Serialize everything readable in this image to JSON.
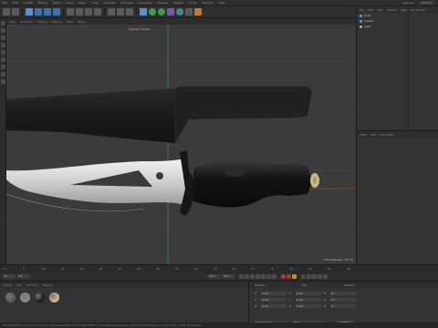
{
  "app": {
    "menu": [
      "File",
      "Edit",
      "Create",
      "Modes",
      "Select",
      "Tools",
      "Mesh",
      "Snap",
      "Animate",
      "Simulate",
      "Character",
      "Pipeline",
      "Plugins",
      "Script",
      "Window",
      "Help"
    ],
    "layout_label": "Layout:",
    "layout_value": "Startup"
  },
  "viewport": {
    "menu": [
      "View",
      "Cameras",
      "Display",
      "Options",
      "Filter",
      "Panel"
    ],
    "camera_label": "Default Camera",
    "grid_spacing": "Grid Spacing : 10 cm",
    "colors": {
      "background": "#3b3b3b",
      "grid_major": "#474747",
      "y_axis": "#3a9a4a",
      "x_axis": "#b24a2a",
      "sheath": "#1a1a1a",
      "blade": "#d8d8d8",
      "handle": "#111111",
      "pommel": "#c9b98a"
    }
  },
  "object_manager": {
    "menu": [
      "File",
      "Edit",
      "View",
      "Objects",
      "Tags",
      "Bookmarks"
    ],
    "objects": [
      {
        "name": "Knife",
        "icon": "null-object-icon"
      },
      {
        "name": "Sheath",
        "icon": "polygon-object-icon"
      },
      {
        "name": "Light",
        "icon": "light-icon"
      }
    ]
  },
  "attribute_manager": {
    "menu": [
      "Mode",
      "Edit",
      "User Data"
    ]
  },
  "timeline": {
    "ticks": [
      "0",
      "5",
      "10",
      "15",
      "20",
      "25",
      "30",
      "35",
      "40",
      "45",
      "50",
      "55",
      "60",
      "65",
      "70",
      "75",
      "80",
      "85",
      "90"
    ],
    "end_label": "0 F"
  },
  "transport": {
    "start_frame": "0 F",
    "current_frame": "0 F",
    "end_frame": "90 F",
    "max_frame": "90 F"
  },
  "material_manager": {
    "menu": [
      "Create",
      "Edit",
      "Function",
      "Texture"
    ],
    "materials": [
      {
        "color": "#5a5a5a"
      },
      {
        "color": "#8a8a8a"
      },
      {
        "color": "#1c1c1c"
      },
      {
        "color": "#c9b98a"
      }
    ]
  },
  "coordinates": {
    "headers": [
      "Position",
      "Size",
      "Rotation"
    ],
    "rows": [
      {
        "axis": "X",
        "pos": "0 cm",
        "size": "0 cm",
        "rot_label": "H",
        "rot": "0 °"
      },
      {
        "axis": "Y",
        "pos": "0 cm",
        "size": "0 cm",
        "rot_label": "P",
        "rot": "0 °"
      },
      {
        "axis": "Z",
        "pos": "0 cm",
        "size": "0 cm",
        "rot_label": "B",
        "rot": "0 °"
      }
    ],
    "mode_select": "Object (Rel)",
    "size_select": "Size",
    "apply_label": "Apply"
  },
  "status": {
    "text": "00:00:00 Move: Click and drag to move elements. Hold down SHIFT to quantize movement / add to the selection in point mode, CTRL to remove."
  }
}
